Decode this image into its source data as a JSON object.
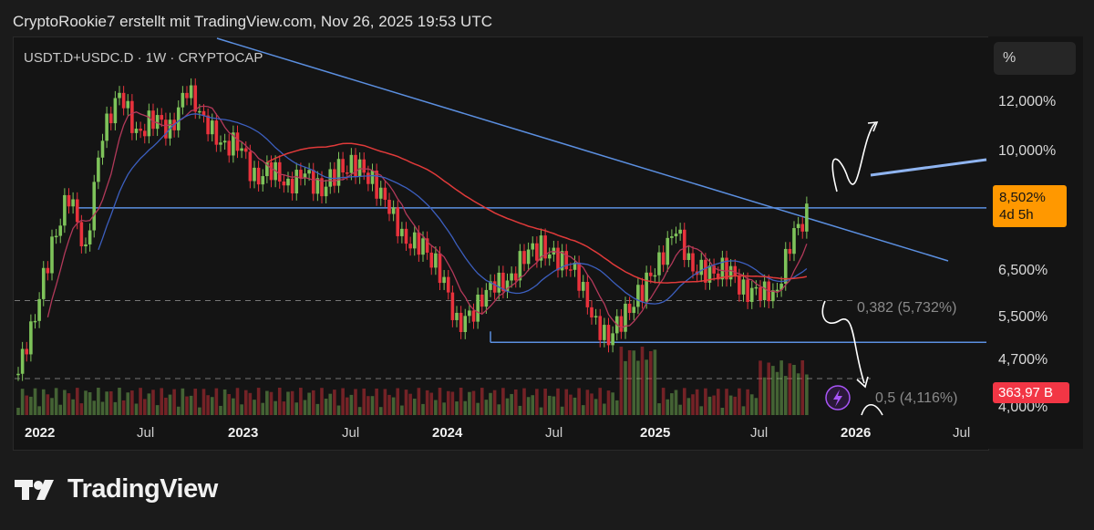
{
  "header": "CryptoRookie7 erstellt mit TradingView.com, Nov 26, 2025 19:53 UTC",
  "symbol": "USDT.D+USDC.D · 1W · CRYPTOCAP",
  "unit": "%",
  "chart_data": {
    "type": "candlestick",
    "title": "USDT.D+USDC.D · 1W · CRYPTOCAP",
    "y_scale": "log",
    "y_ticks": [
      "12,000%",
      "10,000%",
      "8,502%",
      "6,500%",
      "5,500%",
      "4,700%",
      "4,000%"
    ],
    "x_ticks": [
      "2022",
      "Jul",
      "2023",
      "Jul",
      "2024",
      "Jul",
      "2025",
      "Jul",
      "2026",
      "Jul"
    ],
    "last_price": "8,502%",
    "countdown": "4d 5h",
    "volume_label": "363,97 B",
    "fib_levels": [
      {
        "label": "0,382 (5,732%)",
        "value": 5.732
      },
      {
        "label": "0,5 (4,116%)",
        "value": 4.116
      }
    ],
    "horizontal_levels": [
      8.5,
      4.8
    ],
    "price_path": [
      [
        "2022-01",
        4.2
      ],
      [
        "2022-02",
        5.4
      ],
      [
        "2022-03",
        7.2
      ],
      [
        "2022-04",
        9.0
      ],
      [
        "2022-05",
        7.0
      ],
      [
        "2022-06",
        11.5
      ],
      [
        "2022-07",
        14.0
      ],
      [
        "2022-08",
        11.5
      ],
      [
        "2022-09",
        12.5
      ],
      [
        "2022-10",
        11.8
      ],
      [
        "2022-11",
        14.0
      ],
      [
        "2022-12",
        12.5
      ],
      [
        "2023-01",
        11.0
      ],
      [
        "2023-02",
        11.3
      ],
      [
        "2023-03",
        9.6
      ],
      [
        "2023-04",
        10.0
      ],
      [
        "2023-05",
        9.4
      ],
      [
        "2023-06",
        9.8
      ],
      [
        "2023-07",
        9.2
      ],
      [
        "2023-08",
        10.0
      ],
      [
        "2023-09",
        10.2
      ],
      [
        "2023-10",
        9.6
      ],
      [
        "2023-11",
        8.4
      ],
      [
        "2023-12",
        7.4
      ],
      [
        "2024-01",
        7.2
      ],
      [
        "2024-02",
        6.5
      ],
      [
        "2024-03",
        5.2
      ],
      [
        "2024-04",
        5.4
      ],
      [
        "2024-05",
        6.2
      ],
      [
        "2024-06",
        6.1
      ],
      [
        "2024-07",
        7.0
      ],
      [
        "2024-08",
        7.2
      ],
      [
        "2024-09",
        6.8
      ],
      [
        "2024-10",
        6.6
      ],
      [
        "2024-11",
        5.3
      ],
      [
        "2024-12",
        4.9
      ],
      [
        "2025-01",
        5.4
      ],
      [
        "2025-02",
        6.0
      ],
      [
        "2025-03",
        6.8
      ],
      [
        "2025-04",
        7.7
      ],
      [
        "2025-05",
        6.6
      ],
      [
        "2025-06",
        6.4
      ],
      [
        "2025-07",
        6.6
      ],
      [
        "2025-08",
        6.0
      ],
      [
        "2025-09",
        5.9
      ],
      [
        "2025-10",
        6.0
      ],
      [
        "2025-11",
        7.6
      ],
      [
        "2025-12",
        8.5
      ]
    ]
  },
  "brand": "TradingView"
}
